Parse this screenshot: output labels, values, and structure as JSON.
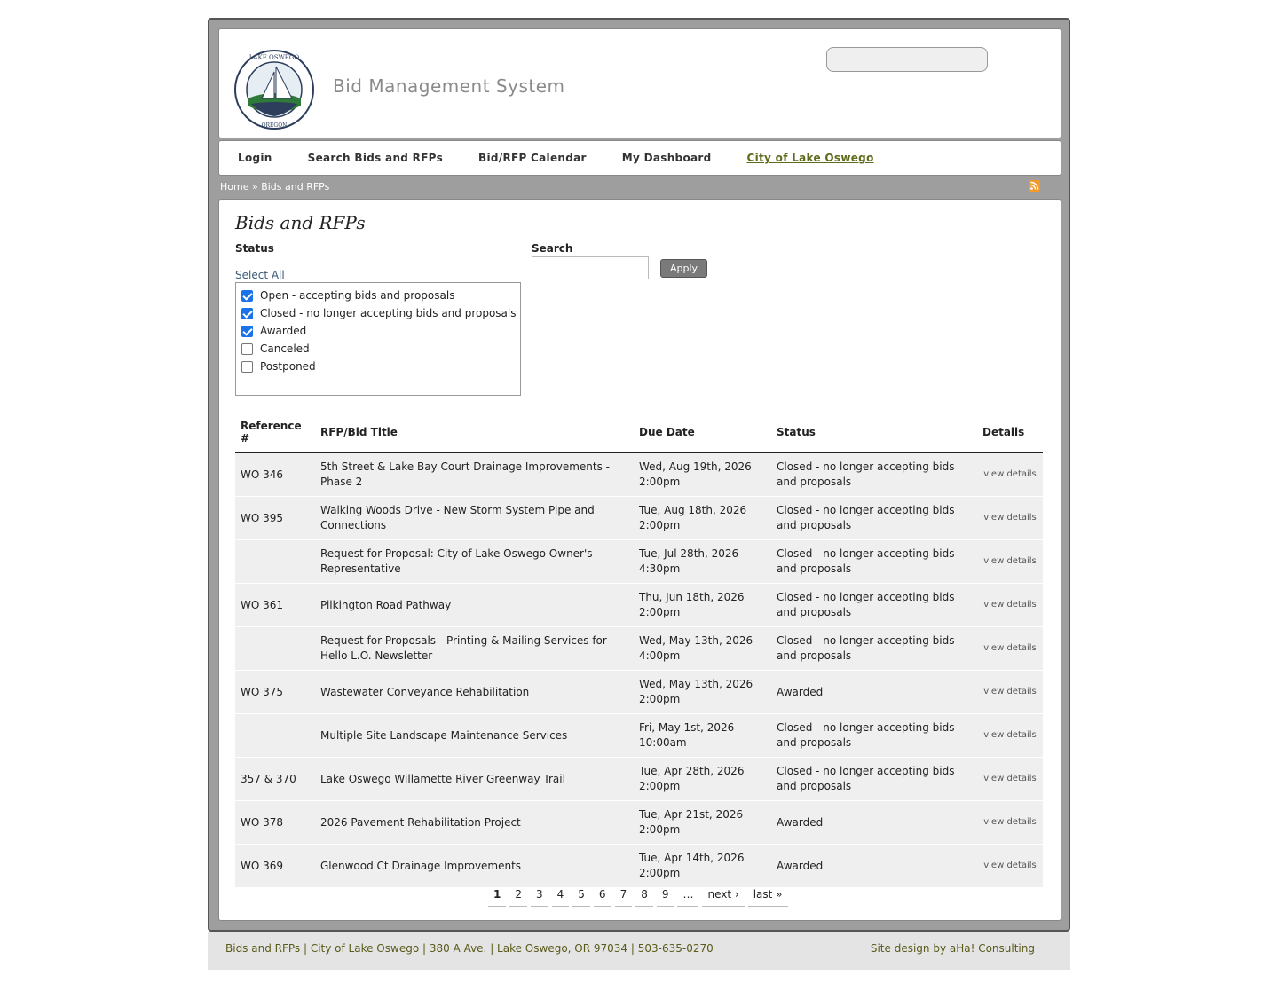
{
  "header": {
    "logo_text": "CITY OF LAKE OSWEGO OREGON",
    "site_title": "Bid Management System",
    "search_placeholder": ""
  },
  "nav": {
    "items": [
      {
        "label": "Login"
      },
      {
        "label": "Search Bids and RFPs"
      },
      {
        "label": "Bid/RFP Calendar"
      },
      {
        "label": "My Dashboard"
      },
      {
        "label": "City of Lake Oswego"
      }
    ]
  },
  "breadcrumb": "Home » Bids and RFPs",
  "main": {
    "title": "Bids and RFPs",
    "status_label": "Status",
    "select_all": "Select All",
    "search_label": "Search",
    "apply_label": "Apply",
    "statuses": [
      {
        "label": "Open - accepting bids and proposals",
        "checked": true
      },
      {
        "label": "Closed - no longer accepting bids and proposals",
        "checked": true
      },
      {
        "label": "Awarded",
        "checked": true
      },
      {
        "label": "Canceled",
        "checked": false
      },
      {
        "label": "Postponed",
        "checked": false
      }
    ]
  },
  "table": {
    "headers": [
      "Reference #",
      "RFP/Bid Title",
      "Due Date",
      "Status",
      "Details"
    ],
    "rows": [
      {
        "ref": "WO 346",
        "title": "5th Street & Lake Bay Court Drainage Improvements - Phase 2",
        "due": "Wed, Aug 19th, 2026 2:00pm",
        "status": "Closed - no longer accepting bids and proposals",
        "details": "view details"
      },
      {
        "ref": "WO 395",
        "title": "Walking Woods Drive - New Storm System Pipe and Connections",
        "due": "Tue, Aug 18th, 2026 2:00pm",
        "status": "Closed - no longer accepting bids and proposals",
        "details": "view details"
      },
      {
        "ref": "",
        "title": "Request for Proposal: City of Lake Oswego Owner's Representative",
        "due": "Tue, Jul 28th, 2026 4:30pm",
        "status": "Closed - no longer accepting bids and proposals",
        "details": "view details"
      },
      {
        "ref": "WO 361",
        "title": "Pilkington Road Pathway",
        "due": "Thu, Jun 18th, 2026 2:00pm",
        "status": "Closed - no longer accepting bids and proposals",
        "details": "view details"
      },
      {
        "ref": "",
        "title": "Request for Proposals - Printing & Mailing Services for Hello L.O. Newsletter",
        "due": "Wed, May 13th, 2026 4:00pm",
        "status": "Closed - no longer accepting bids and proposals",
        "details": "view details"
      },
      {
        "ref": "WO 375",
        "title": "Wastewater Conveyance Rehabilitation",
        "due": "Wed, May 13th, 2026 2:00pm",
        "status": "Awarded",
        "details": "view details"
      },
      {
        "ref": "",
        "title": "Multiple Site Landscape Maintenance Services",
        "due": "Fri, May 1st, 2026 10:00am",
        "status": "Closed - no longer accepting bids and proposals",
        "details": "view details"
      },
      {
        "ref": "357 & 370",
        "title": "Lake Oswego Willamette River Greenway Trail",
        "due": "Tue, Apr 28th, 2026 2:00pm",
        "status": "Closed - no longer accepting bids and proposals",
        "details": "view details"
      },
      {
        "ref": "WO 378",
        "title": "2026 Pavement Rehabilitation Project",
        "due": "Tue, Apr 21st, 2026 2:00pm",
        "status": "Awarded",
        "details": "view details"
      },
      {
        "ref": "WO 369",
        "title": "Glenwood Ct Drainage Improvements",
        "due": "Tue, Apr 14th, 2026 2:00pm",
        "status": "Awarded",
        "details": "view details"
      }
    ]
  },
  "pager": {
    "pages": [
      "1",
      "2",
      "3",
      "4",
      "5",
      "6",
      "7",
      "8",
      "9",
      "…",
      "next ›",
      "last »"
    ],
    "current": "1"
  },
  "footer": {
    "left": "Bids and RFPs | City of Lake Oswego | 380 A Ave. | Lake Oswego, OR 97034 | 503-635-0270",
    "right": "Site design by aHa! Consulting"
  },
  "colors": {
    "frame": "#9e9e9e",
    "nav_link_city": "#5f6b1b",
    "checkbox_checked": "#1a73e8",
    "row_bg": "#efefef",
    "rss": "#f39a2a"
  }
}
